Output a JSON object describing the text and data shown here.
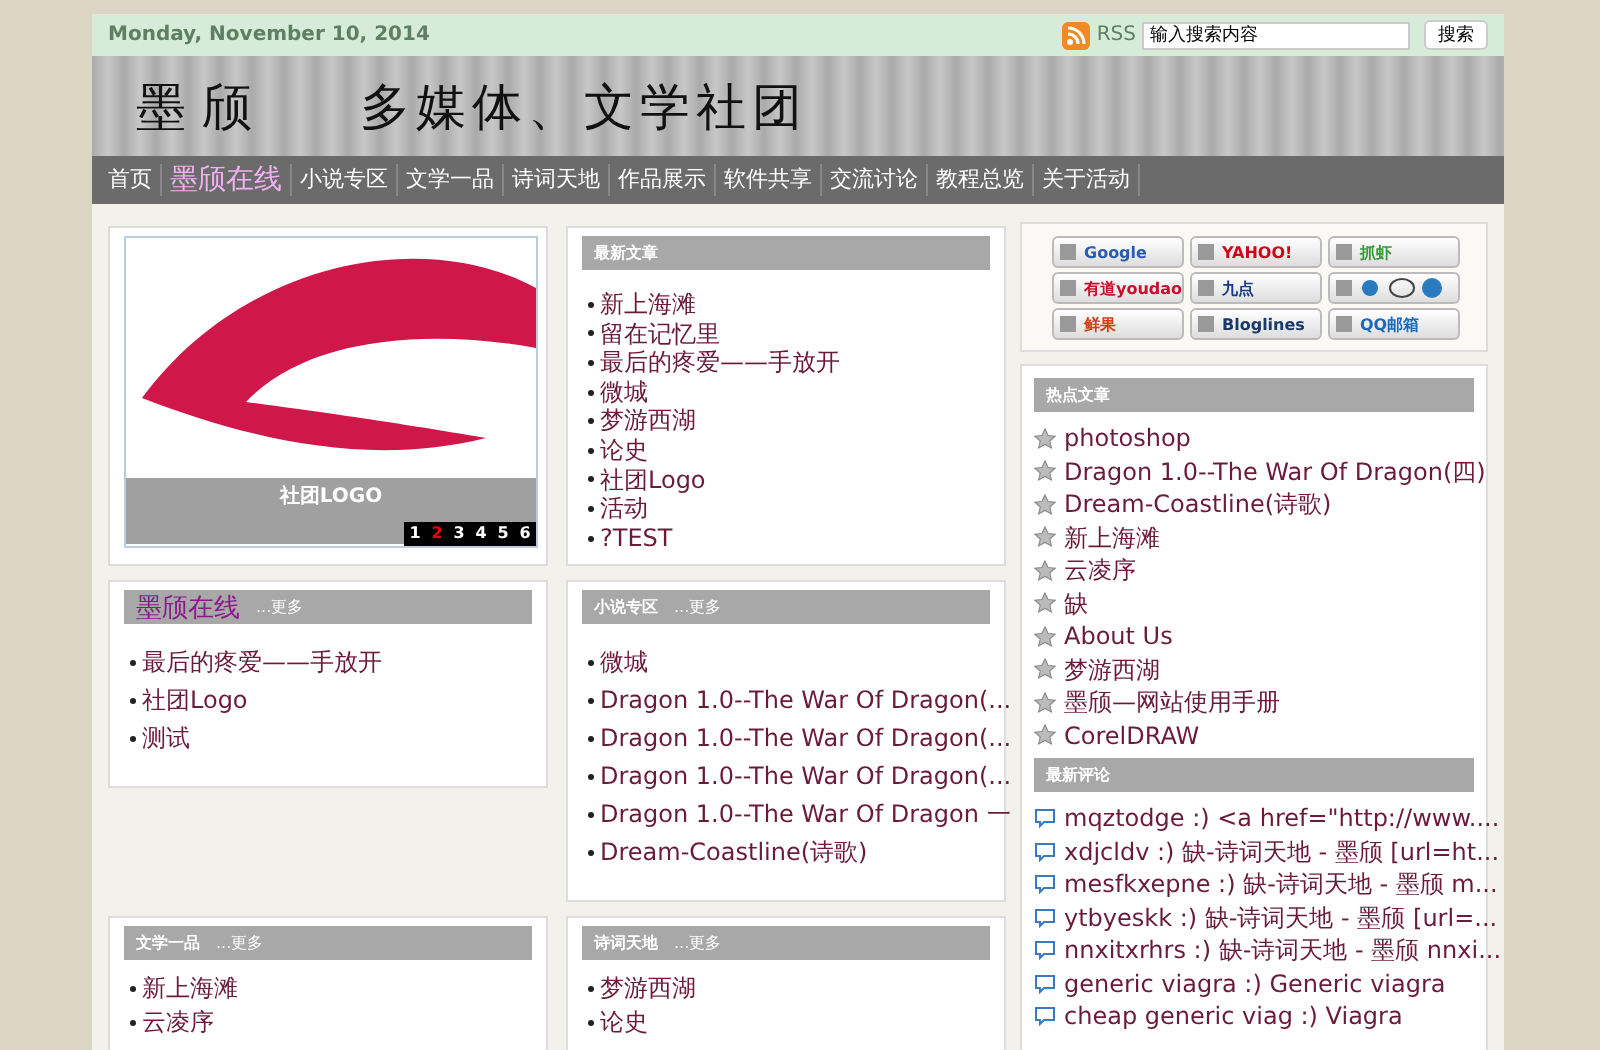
{
  "top_bar": {
    "date": "Monday, November 10, 2014",
    "rss_label": "RSS",
    "search": {
      "value": "输入搜索内容"
    },
    "search_button": "搜索"
  },
  "banner": {
    "title": "墨颀",
    "subtitle": "多媒体、文学社团"
  },
  "nav": [
    {
      "label": "首页",
      "selected": false
    },
    {
      "label": "墨颀在线",
      "selected": true
    },
    {
      "label": "小说专区",
      "selected": false
    },
    {
      "label": "文学一品",
      "selected": false
    },
    {
      "label": "诗词天地",
      "selected": false
    },
    {
      "label": "作品展示",
      "selected": false
    },
    {
      "label": "软件共享",
      "selected": false
    },
    {
      "label": "交流讨论",
      "selected": false
    },
    {
      "label": "教程总览",
      "selected": false
    },
    {
      "label": "关于活动",
      "selected": false
    }
  ],
  "slideshow": {
    "caption": "社团LOGO",
    "pages": [
      {
        "label": "1",
        "selected": false
      },
      {
        "label": "2",
        "selected": true
      },
      {
        "label": "3",
        "selected": false
      },
      {
        "label": "4",
        "selected": false
      },
      {
        "label": "5",
        "selected": false
      },
      {
        "label": "6",
        "selected": false
      }
    ]
  },
  "panels": [
    {
      "title": "最新文章",
      "highlight": false,
      "items": [
        "新上海滩",
        "留在记忆里",
        "最后的疼爱——手放开",
        "微城",
        "梦游西湖",
        "论史",
        "社团Logo",
        "活动",
        "?TEST"
      ]
    },
    {
      "title": "墨颀在线",
      "highlight": true,
      "more": "...更多",
      "items": [
        "最后的疼爱——手放开",
        "社团Logo",
        "测试"
      ]
    },
    {
      "title": "小说专区",
      "highlight": false,
      "more": "...更多",
      "items": [
        "微城",
        "Dragon 1.0--The War Of Dragon(...",
        "Dragon 1.0--The War Of Dragon(...",
        "Dragon 1.0--The War Of Dragon(...",
        "Dragon 1.0--The War Of Dragon 一",
        "Dream-Coastline(诗歌)"
      ]
    },
    {
      "title": "文学一品",
      "highlight": false,
      "more": "...更多",
      "items": [
        "新上海滩",
        "云凌序"
      ]
    },
    {
      "title": "诗词天地",
      "highlight": false,
      "more": "...更多",
      "items": [
        "梦游西湖",
        "论史"
      ]
    }
  ],
  "bookmarks": [
    {
      "kind": "text",
      "label": "Google",
      "color": "#2a5db0"
    },
    {
      "kind": "text",
      "label": "YAHOO!",
      "color": "#d0021b"
    },
    {
      "kind": "text",
      "label": "抓虾",
      "color": "#3a9a3a"
    },
    {
      "kind": "text",
      "label": "有道youdao",
      "color": "#c8102e"
    },
    {
      "kind": "text",
      "label": "九点",
      "color": "#1a3a8a"
    },
    {
      "kind": "icons",
      "color": "#2a7ac0"
    },
    {
      "kind": "text",
      "label": "鲜果",
      "color": "#d04010"
    },
    {
      "kind": "text",
      "label": "Bloglines",
      "color": "#1a3a6a"
    },
    {
      "kind": "text",
      "label": "QQ邮箱",
      "color": "#1a6ac0"
    }
  ],
  "hot_articles": {
    "title": "热点文章",
    "items": [
      "photoshop",
      "Dragon 1.0--The War Of Dragon(四)",
      "Dream-Coastline(诗歌)",
      "新上海滩",
      "云凌序",
      "缺",
      "About Us",
      "梦游西湖",
      "墨颀—网站使用手册",
      "CorelDRAW"
    ]
  },
  "recent_comments": {
    "title": "最新评论",
    "items": [
      "mqztodge :) <a href=\"http://www....",
      "xdjcldv :) 缺-诗词天地 - 墨颀 [url=ht...",
      "mesfkxepne :) 缺-诗词天地 - 墨颀 m...",
      "ytbyeskk :) 缺-诗词天地 - 墨颀 [url=...",
      "nnxitxrhrs :) 缺-诗词天地 - 墨颀 nnxi...",
      "generic viagra :) Generic viagra",
      "cheap generic viag :) Viagra"
    ]
  }
}
